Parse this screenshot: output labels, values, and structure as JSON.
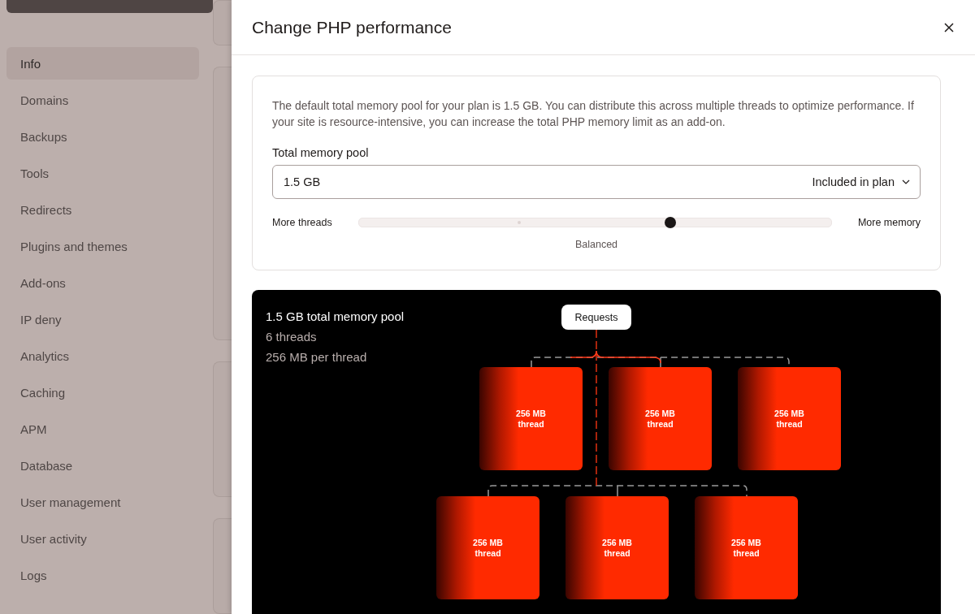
{
  "sidebar": {
    "items": [
      {
        "label": "Info",
        "selected": true
      },
      {
        "label": "Domains",
        "selected": false
      },
      {
        "label": "Backups",
        "selected": false
      },
      {
        "label": "Tools",
        "selected": false
      },
      {
        "label": "Redirects",
        "selected": false
      },
      {
        "label": "Plugins and themes",
        "selected": false
      },
      {
        "label": "Add-ons",
        "selected": false
      },
      {
        "label": "IP deny",
        "selected": false
      },
      {
        "label": "Analytics",
        "selected": false
      },
      {
        "label": "Caching",
        "selected": false
      },
      {
        "label": "APM",
        "selected": false
      },
      {
        "label": "Database",
        "selected": false
      },
      {
        "label": "User management",
        "selected": false
      },
      {
        "label": "User activity",
        "selected": false
      },
      {
        "label": "Logs",
        "selected": false
      }
    ]
  },
  "modal": {
    "title": "Change PHP performance",
    "description": "The default total memory pool for your plan is 1.5 GB. You can distribute this across multiple threads to optimize performance. If your site is resource-intensive, you can increase the total PHP memory limit as an add-on.",
    "pool_label": "Total memory pool",
    "pool_select": {
      "value": "1.5 GB",
      "note": "Included in plan"
    },
    "slider": {
      "left_label": "More threads",
      "right_label": "More memory",
      "level": 0.66,
      "caption": "Balanced"
    },
    "diagram": {
      "heading": "1.5 GB total memory pool",
      "threads_count": "6 threads",
      "per_thread": "256 MB per thread",
      "source": "Requests",
      "thread_rows": [
        {
          "threads": [
            {
              "size": "256 MB",
              "label": "thread"
            },
            {
              "size": "256 MB",
              "label": "thread"
            },
            {
              "size": "256 MB",
              "label": "thread"
            }
          ]
        },
        {
          "threads": [
            {
              "size": "256 MB",
              "label": "thread"
            },
            {
              "size": "256 MB",
              "label": "thread"
            },
            {
              "size": "256 MB",
              "label": "thread"
            }
          ]
        }
      ]
    }
  }
}
